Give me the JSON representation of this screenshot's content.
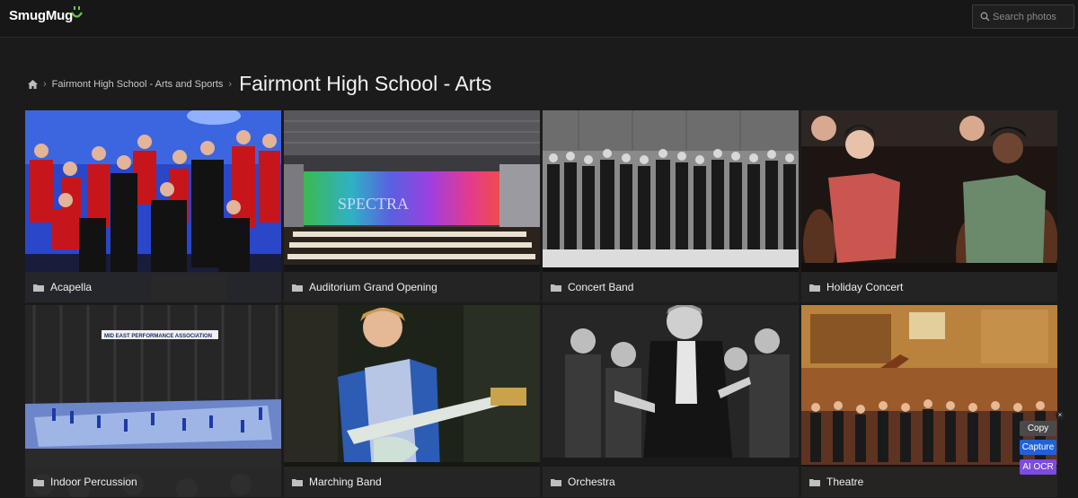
{
  "app": {
    "logo_text": "SmugMug",
    "logo_icon": "smiley-face-icon",
    "accent": "#6cc644"
  },
  "search": {
    "placeholder": "Search photos",
    "icon": "search-icon"
  },
  "breadcrumb": {
    "home_icon": "home-icon",
    "items": [
      "Fairmont High School - Arts and Sports"
    ],
    "current": "Fairmont High School - Arts"
  },
  "galleries": [
    {
      "label": "Acapella",
      "icon": "folder-icon"
    },
    {
      "label": "Auditorium Grand Opening",
      "icon": "folder-icon"
    },
    {
      "label": "Concert Band",
      "icon": "folder-icon"
    },
    {
      "label": "Holiday Concert",
      "icon": "folder-icon"
    },
    {
      "label": "Indoor Percussion",
      "icon": "folder-icon"
    },
    {
      "label": "Marching Band",
      "icon": "folder-icon"
    },
    {
      "label": "Orchestra",
      "icon": "folder-icon"
    },
    {
      "label": "Theatre",
      "icon": "folder-icon"
    }
  ],
  "banner_text": "MID EAST PERFORMANCE ASSOCIATION",
  "stage_text": "SPECTRA",
  "ocr_tool": {
    "copy": "Copy",
    "capture": "Capture",
    "ai_ocr": "AI OCR",
    "close": "×"
  }
}
